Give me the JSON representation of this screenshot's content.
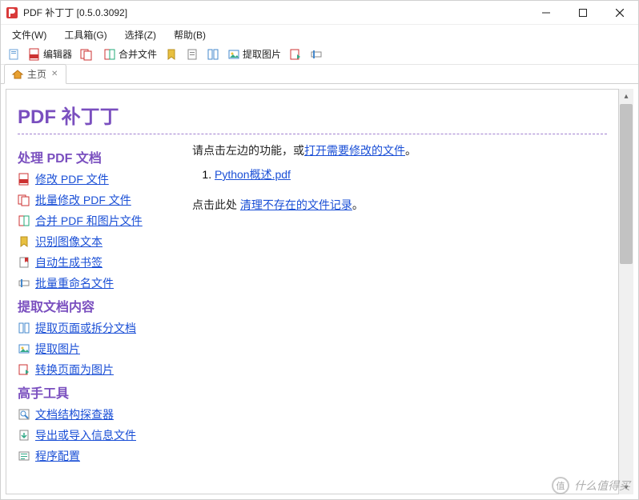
{
  "window": {
    "title": "PDF 补丁丁 [0.5.0.3092]"
  },
  "menubar": {
    "file": "文件(W)",
    "toolbox": "工具箱(G)",
    "select": "选择(Z)",
    "help": "帮助(B)"
  },
  "toolbar": {
    "editor": "编辑器",
    "batch_modify": "批量修改文件",
    "merge": "合并文件",
    "extract_img": "提取图片"
  },
  "tabs": {
    "home": {
      "label": "主页"
    }
  },
  "page": {
    "title": "PDF 补丁丁",
    "sections": {
      "process": {
        "title": "处理 PDF 文档",
        "modify": "修改 PDF 文件",
        "batch": "批量修改 PDF 文件",
        "merge": "合并 PDF 和图片文件",
        "ocr": "识别图像文本",
        "bookmarks": "自动生成书签",
        "rename": "批量重命名文件"
      },
      "extract": {
        "title": "提取文档内容",
        "pages": "提取页面或拆分文档",
        "images": "提取图片",
        "convert": "转换页面为图片"
      },
      "advanced": {
        "title": "高手工具",
        "inspector": "文档结构探查器",
        "export": "导出或导入信息文件",
        "config": "程序配置"
      }
    },
    "right": {
      "intro_pre": "请点击左边的功能，或",
      "intro_link": "打开需要修改的文件",
      "intro_post": "。",
      "recent_1": "Python概述.pdf",
      "clean_pre": "点击此处 ",
      "clean_link": "清理不存在的文件记录",
      "clean_post": "。"
    }
  },
  "watermark": {
    "text": "什么值得买",
    "mark": "值"
  }
}
